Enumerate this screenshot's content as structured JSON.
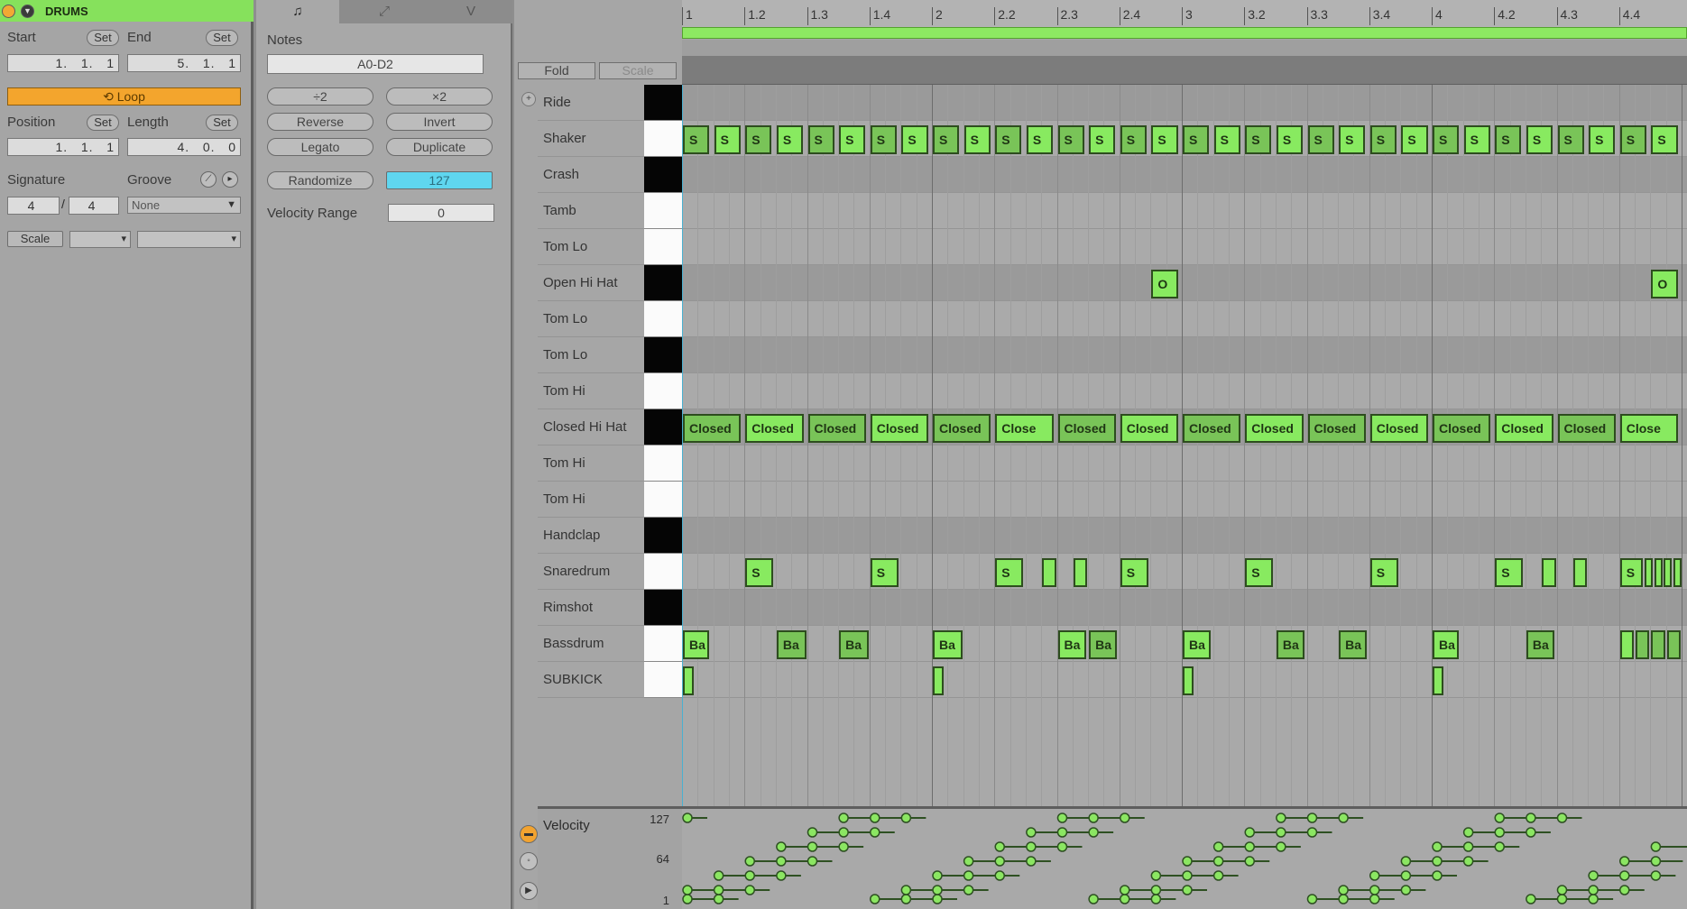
{
  "clip": {
    "title": "DRUMS",
    "start_label": "Start",
    "end_label": "End",
    "set_label": "Set",
    "start_value": "1.   1.   1",
    "end_value": "5.   1.   1",
    "loop_label": "Loop",
    "position_label": "Position",
    "length_label": "Length",
    "position_value": "1.   1.   1",
    "length_value": "4.   0.   0",
    "signature_label": "Signature",
    "groove_label": "Groove",
    "sig_num": "4",
    "sig_den": "4",
    "groove_value": "None",
    "scale_label": "Scale"
  },
  "notes_panel": {
    "tabs": [
      "♫",
      "⤢",
      "V"
    ],
    "notes_label": "Notes",
    "range": "A0-D2",
    "btn_double_left": "÷2",
    "btn_double_right": "×2",
    "reverse": "Reverse",
    "invert": "Invert",
    "legato": "Legato",
    "duplicate": "Duplicate",
    "randomize": "Randomize",
    "randomize_value": "127",
    "velocity_range_label": "Velocity Range",
    "velocity_range_value": "0"
  },
  "editor": {
    "fold_label": "Fold",
    "scale_label": "Scale",
    "ruler": [
      "1",
      "1.2",
      "1.3",
      "1.4",
      "2",
      "2.2",
      "2.3",
      "2.4",
      "3",
      "3.2",
      "3.3",
      "3.4",
      "4",
      "4.2",
      "4.3",
      "4.4"
    ],
    "lanes": [
      {
        "name": "Ride",
        "key": "black"
      },
      {
        "name": "Shaker",
        "key": "white"
      },
      {
        "name": "Crash",
        "key": "black"
      },
      {
        "name": "Tamb",
        "key": "white"
      },
      {
        "name": "Tom Lo",
        "key": "white"
      },
      {
        "name": "Open Hi Hat",
        "key": "black"
      },
      {
        "name": "Tom Lo",
        "key": "white"
      },
      {
        "name": "Tom Lo",
        "key": "black"
      },
      {
        "name": "Tom Hi",
        "key": "white"
      },
      {
        "name": "Closed Hi Hat",
        "key": "black"
      },
      {
        "name": "Tom Hi",
        "key": "white"
      },
      {
        "name": "Tom Hi",
        "key": "white"
      },
      {
        "name": "Handclap",
        "key": "black"
      },
      {
        "name": "Snaredrum",
        "key": "white"
      },
      {
        "name": "Rimshot",
        "key": "black"
      },
      {
        "name": "Bassdrum",
        "key": "white"
      },
      {
        "name": "SUBKICK",
        "key": "white"
      }
    ],
    "velocity_label": "Velocity",
    "velocity_ticks": [
      "127",
      "64",
      "1"
    ]
  },
  "notes_data": {
    "beats": 16,
    "shaker": {
      "lane": 1,
      "label": "S",
      "starts": [
        0,
        0.5,
        1,
        1.5,
        2,
        2.5,
        3,
        3.5,
        4,
        4.5,
        5,
        5.5,
        6,
        6.5,
        7,
        7.5,
        8,
        8.5,
        9,
        9.5,
        10,
        10.5,
        11,
        11.5,
        12,
        12.5,
        13,
        13.5,
        14,
        14.5,
        15,
        15.5
      ],
      "length": 0.45
    },
    "open_hat": {
      "lane": 5,
      "label": "O",
      "starts": [
        7.5,
        15.5
      ],
      "length": 0.45
    },
    "closed_hat": {
      "lane": 9,
      "labels": [
        "Closed",
        "Closed",
        "Closed",
        "Closed",
        "Closed",
        "Close",
        "Closed",
        "Closed",
        "Closed",
        "Closed",
        "Closed",
        "Closed",
        "Closed",
        "Closed",
        "Closed",
        "Close"
      ],
      "length": 0.96
    },
    "snare": {
      "lane": 13,
      "label": "S",
      "notes": [
        [
          1,
          0.48
        ],
        [
          3,
          0.48
        ],
        [
          5,
          0.48
        ],
        [
          5.75,
          0.25
        ],
        [
          6.25,
          0.25
        ],
        [
          7,
          0.48
        ],
        [
          9,
          0.48
        ],
        [
          11,
          0.48
        ],
        [
          13,
          0.48
        ],
        [
          13.75,
          0.25
        ],
        [
          14.25,
          0.25
        ],
        [
          15,
          0.4
        ],
        [
          15.4,
          0.15
        ],
        [
          15.55,
          0.15
        ],
        [
          15.7,
          0.15
        ],
        [
          15.85,
          0.15
        ]
      ]
    },
    "bass": {
      "lane": 15,
      "label": "Ba",
      "notes": [
        [
          0,
          0.45
        ],
        [
          1.5,
          0.5
        ],
        [
          2.5,
          0.5
        ],
        [
          4,
          0.5
        ],
        [
          6,
          0.48
        ],
        [
          6.5,
          0.48
        ],
        [
          8,
          0.48
        ],
        [
          9.5,
          0.48
        ],
        [
          10.5,
          0.48
        ],
        [
          12,
          0.45
        ],
        [
          13.5,
          0.48
        ],
        [
          15,
          0.25
        ],
        [
          15.25,
          0.25
        ],
        [
          15.5,
          0.25
        ],
        [
          15.75,
          0.25
        ]
      ]
    },
    "subkick": {
      "lane": 16,
      "label": "",
      "starts": [
        0,
        4,
        8,
        12
      ],
      "length": 0.2
    }
  }
}
